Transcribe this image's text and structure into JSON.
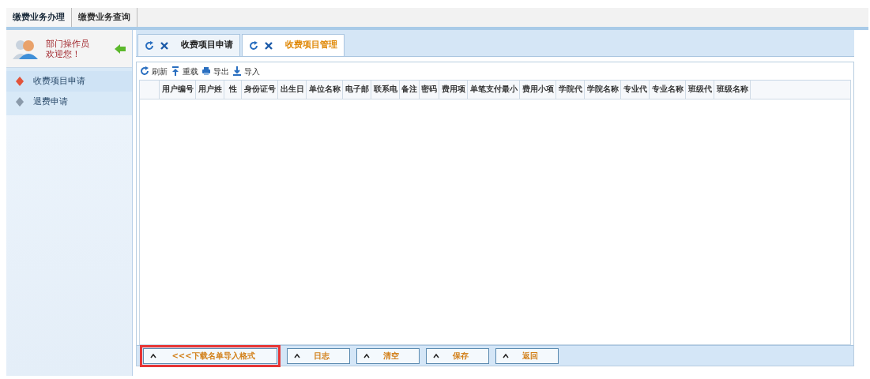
{
  "top_menu": [
    {
      "label": "缴费业务办理",
      "selected": true
    },
    {
      "label": "缴费业务查询",
      "selected": false
    }
  ],
  "sidebar": {
    "user_role": "部门操作员",
    "greeting": "欢迎您！",
    "items": [
      {
        "label": "收费项目申请",
        "selected": true
      },
      {
        "label": "退费申请",
        "selected": false
      }
    ]
  },
  "tabs": [
    {
      "label": "收费项目申请",
      "selected": false
    },
    {
      "label": "收费项目管理",
      "selected": true
    }
  ],
  "toolbar": [
    {
      "kind": "refresh",
      "label": "刷新"
    },
    {
      "kind": "reload",
      "label": "重载"
    },
    {
      "kind": "export",
      "label": "导出"
    },
    {
      "kind": "import",
      "label": "导入"
    }
  ],
  "table": {
    "columns": [
      "用户编号",
      "用户姓",
      "性",
      "身份证号",
      "出生日",
      "单位名称",
      "电子邮",
      "联系电",
      "备注",
      "密码",
      "费用项",
      "单笔支付最小",
      "费用小项",
      "学院代",
      "学院名称",
      "专业代",
      "专业名称",
      "班级代",
      "班级名称"
    ]
  },
  "buttons": [
    {
      "label": "<<<下载名单导入格式",
      "highlighted": true
    },
    {
      "label": "日志",
      "highlighted": false
    },
    {
      "label": "清空",
      "highlighted": false
    },
    {
      "label": "保存",
      "highlighted": false
    },
    {
      "label": "返回",
      "highlighted": false
    }
  ]
}
